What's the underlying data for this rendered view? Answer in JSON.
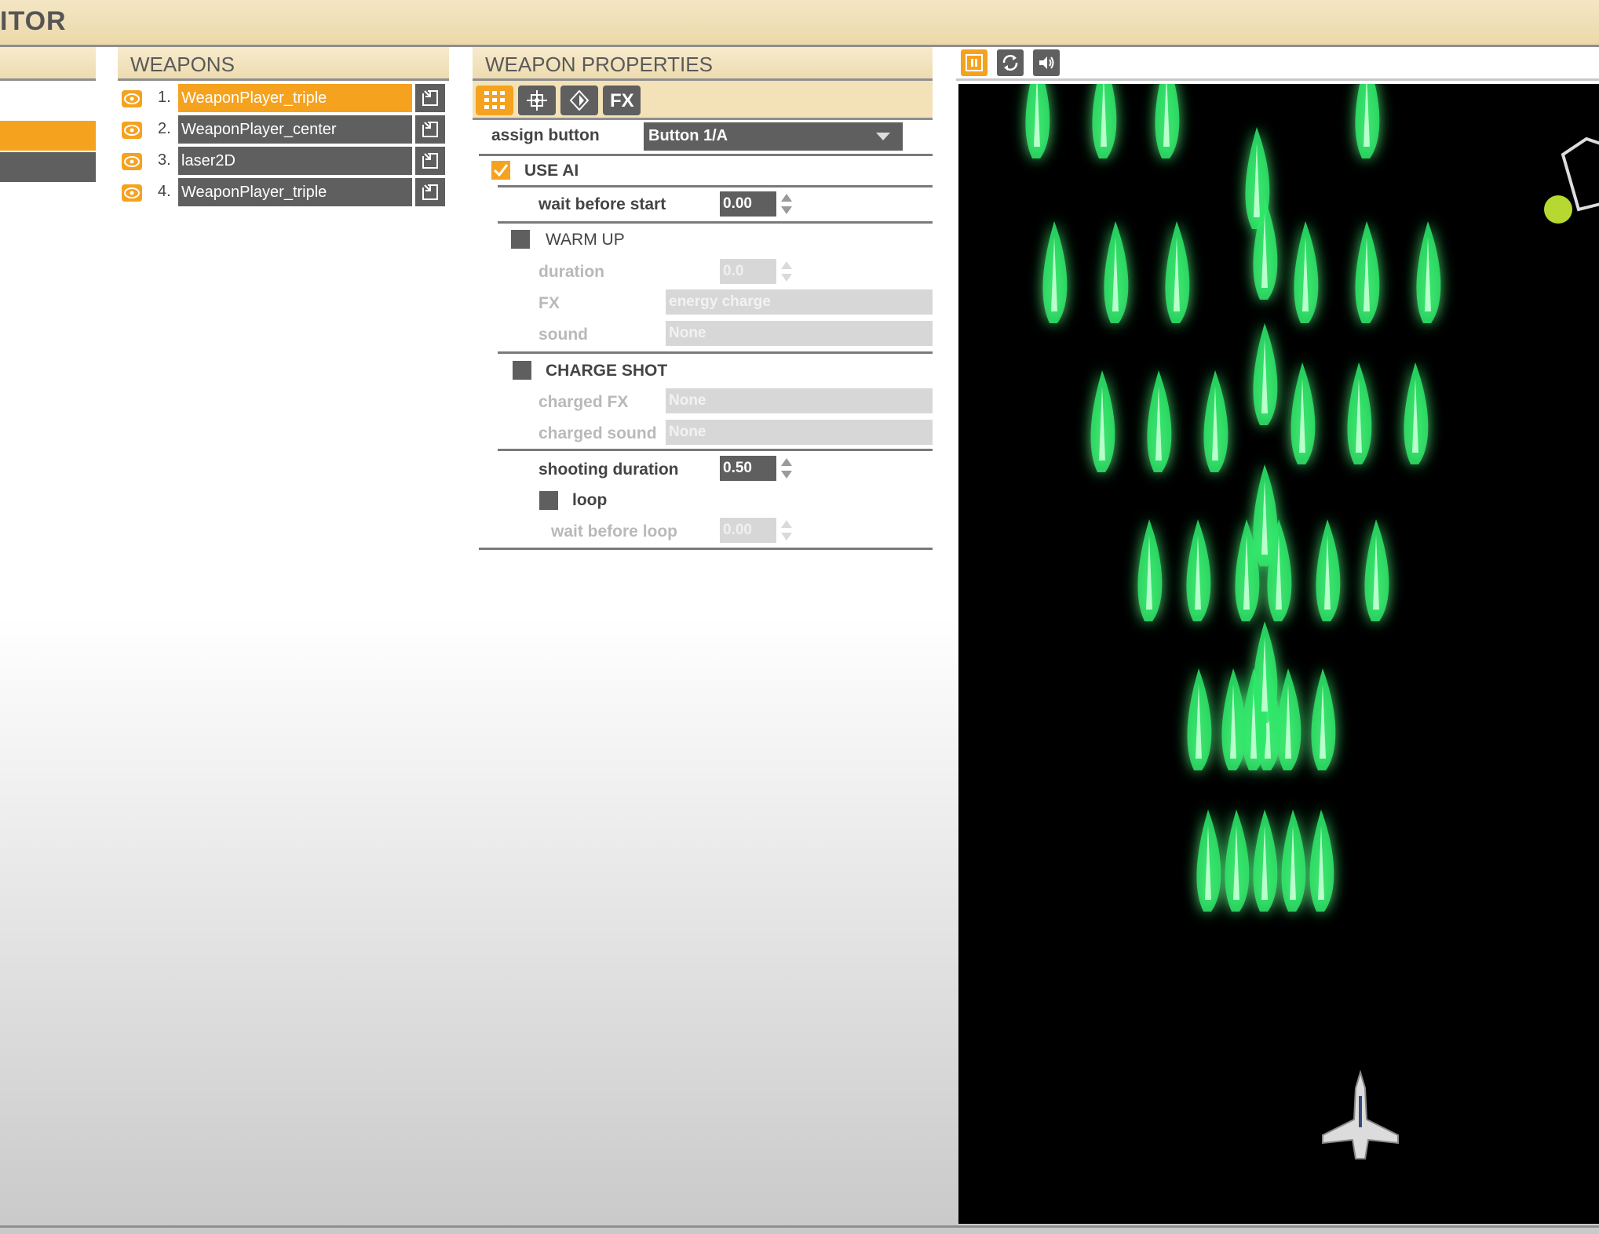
{
  "app": {
    "title": "ITOR"
  },
  "weapons_panel": {
    "title": "WEAPONS",
    "items": [
      {
        "index": "1.",
        "name": "WeaponPlayer_triple",
        "selected": true
      },
      {
        "index": "2.",
        "name": "WeaponPlayer_center",
        "selected": false
      },
      {
        "index": "3.",
        "name": "laser2D",
        "selected": false
      },
      {
        "index": "4.",
        "name": "WeaponPlayer_triple",
        "selected": false
      }
    ]
  },
  "properties_panel": {
    "title": "WEAPON PROPERTIES",
    "tabs": [
      {
        "icon": "grid-icon",
        "active": true
      },
      {
        "icon": "target-icon",
        "active": false
      },
      {
        "icon": "diamond-icon",
        "active": false
      },
      {
        "label": "FX",
        "active": false
      }
    ],
    "assign_button": {
      "label": "assign button",
      "value": "Button 1/A"
    },
    "use_ai": {
      "label": "USE AI",
      "checked": true
    },
    "wait_before_start": {
      "label": "wait before start",
      "value": "0.00"
    },
    "warm_up": {
      "label": "WARM UP",
      "checked": false,
      "duration_label": "duration",
      "duration_value": "0.0",
      "fx_label": "FX",
      "fx_value": "energy charge",
      "sound_label": "sound",
      "sound_value": "None"
    },
    "charge_shot": {
      "label": "CHARGE SHOT",
      "checked": false,
      "charged_fx_label": "charged FX",
      "charged_fx_value": "None",
      "charged_sound_label": "charged sound",
      "charged_sound_value": "None"
    },
    "shooting_duration": {
      "label": "shooting duration",
      "value": "0.50"
    },
    "loop": {
      "label": "loop",
      "checked": false
    },
    "wait_before_loop": {
      "label": "wait before loop",
      "value": "0.00"
    }
  },
  "preview": {
    "toolbar": [
      "pause-icon",
      "refresh-icon",
      "speaker-icon"
    ],
    "colors": {
      "projectile": "#2ee86a",
      "background": "#000000"
    }
  }
}
